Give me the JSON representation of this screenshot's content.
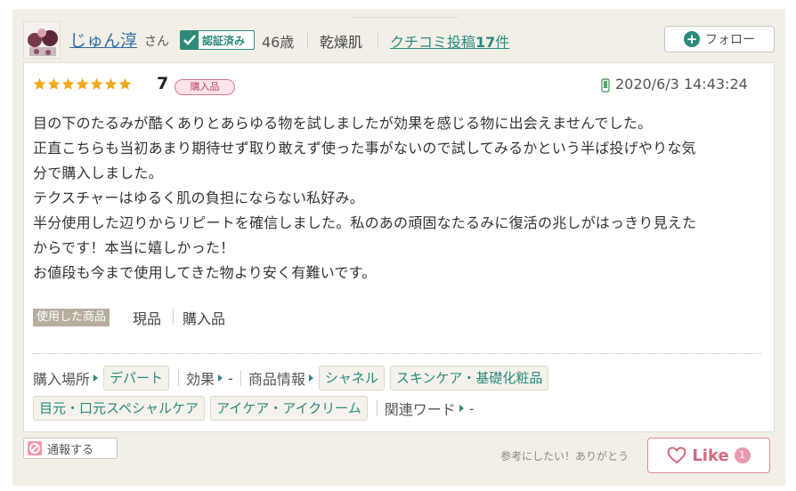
{
  "reviewer": {
    "name": "じゅん淳",
    "honorific": "さん",
    "verified_label": "認証済み",
    "age": "46歳",
    "skin_type": "乾燥肌",
    "posts_prefix": "クチコミ投稿",
    "posts_count": "17",
    "posts_suffix": "件",
    "follow_label": "フォロー"
  },
  "review": {
    "stars_filled": 7,
    "stars_total": 7,
    "rating": "7",
    "purchased_badge": "購入品",
    "posted_via_icon": "mobile-phone-icon",
    "date": "2020/6/3 14:43:24",
    "body_lines": [
      "目の下のたるみが酷くありとあらゆる物を試しましたが効果を感じる物に出会えませんでした。",
      "正直こちらも当初あまり期待せず取り敢えず使った事がないので試してみるかという半ば投げやりな気",
      "分で購入しました。",
      "テクスチャーはゆるく肌の負担にならない私好み。",
      "半分使用した辺りからリピートを確信しました。私のあの頑固なたるみに復活の兆しがはっきり見えた",
      "からです！本当に嬉しかった！",
      "お値段も今まで使用してきた物より安く有難いです。"
    ],
    "used_product_label": "使用した商品",
    "used_items": [
      "現品",
      "購入品"
    ]
  },
  "tags": {
    "purchase_place_label": "購入場所",
    "purchase_place": "デパート",
    "effect_label": "効果",
    "effect_value": "-",
    "product_info_label": "商品情報",
    "product_info": [
      "シャネル",
      "スキンケア・基礎化粧品",
      "目元・口元スペシャルケア",
      "アイケア・アイクリーム"
    ],
    "related_words_label": "関連ワード",
    "related_words_value": "-"
  },
  "footer": {
    "report_label": "通報する",
    "helpful_text": "参考にしたい！ありがとう",
    "like_label": "Like",
    "like_count": "1"
  },
  "colors": {
    "panel_bg": "#f2efe6",
    "link_blue": "#2f6da8",
    "teal": "#2d8a7b",
    "star_gold": "#f0a81c",
    "like_pink": "#d5667f"
  }
}
